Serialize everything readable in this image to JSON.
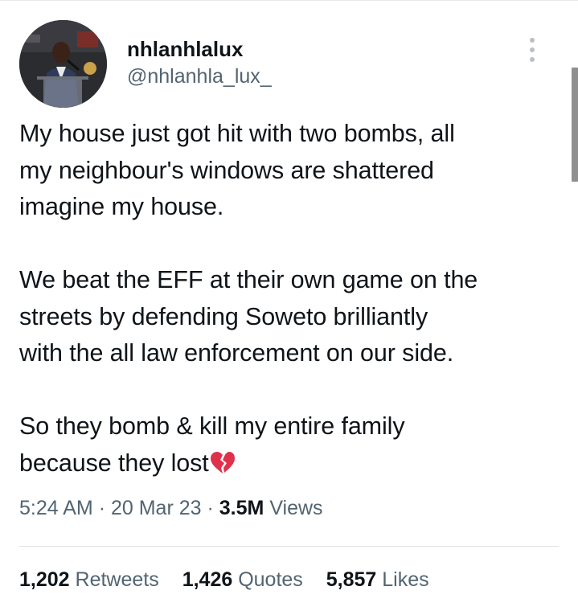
{
  "tweet": {
    "display_name": "nhlanhlalux",
    "handle": "@nhlanhla_lux_",
    "text_line_group_1": "My house just got hit with two bombs, all\nmy neighbour's windows are shattered\nimagine my house.",
    "text_line_group_2": "We beat the EFF at their own game on the\nstreets by defending Soweto brilliantly\nwith the all law enforcement on our side.",
    "text_line_group_3": "So they bomb & kill my entire family\nbecause they lost",
    "emoji": "broken-heart-icon",
    "time": "5:24 AM",
    "date": "20 Mar 23",
    "separator": "·",
    "views_count": "3.5M",
    "views_label": "Views"
  },
  "stats": {
    "retweets_count": "1,202",
    "retweets_label": "Retweets",
    "quotes_count": "1,426",
    "quotes_label": "Quotes",
    "likes_count": "5,857",
    "likes_label": "Likes"
  },
  "colors": {
    "text_primary": "#0f1419",
    "text_secondary": "#536471",
    "emoji_red": "#e0314b"
  },
  "icons": {
    "more_menu": "more-vertical-icon",
    "avatar": "avatar"
  }
}
